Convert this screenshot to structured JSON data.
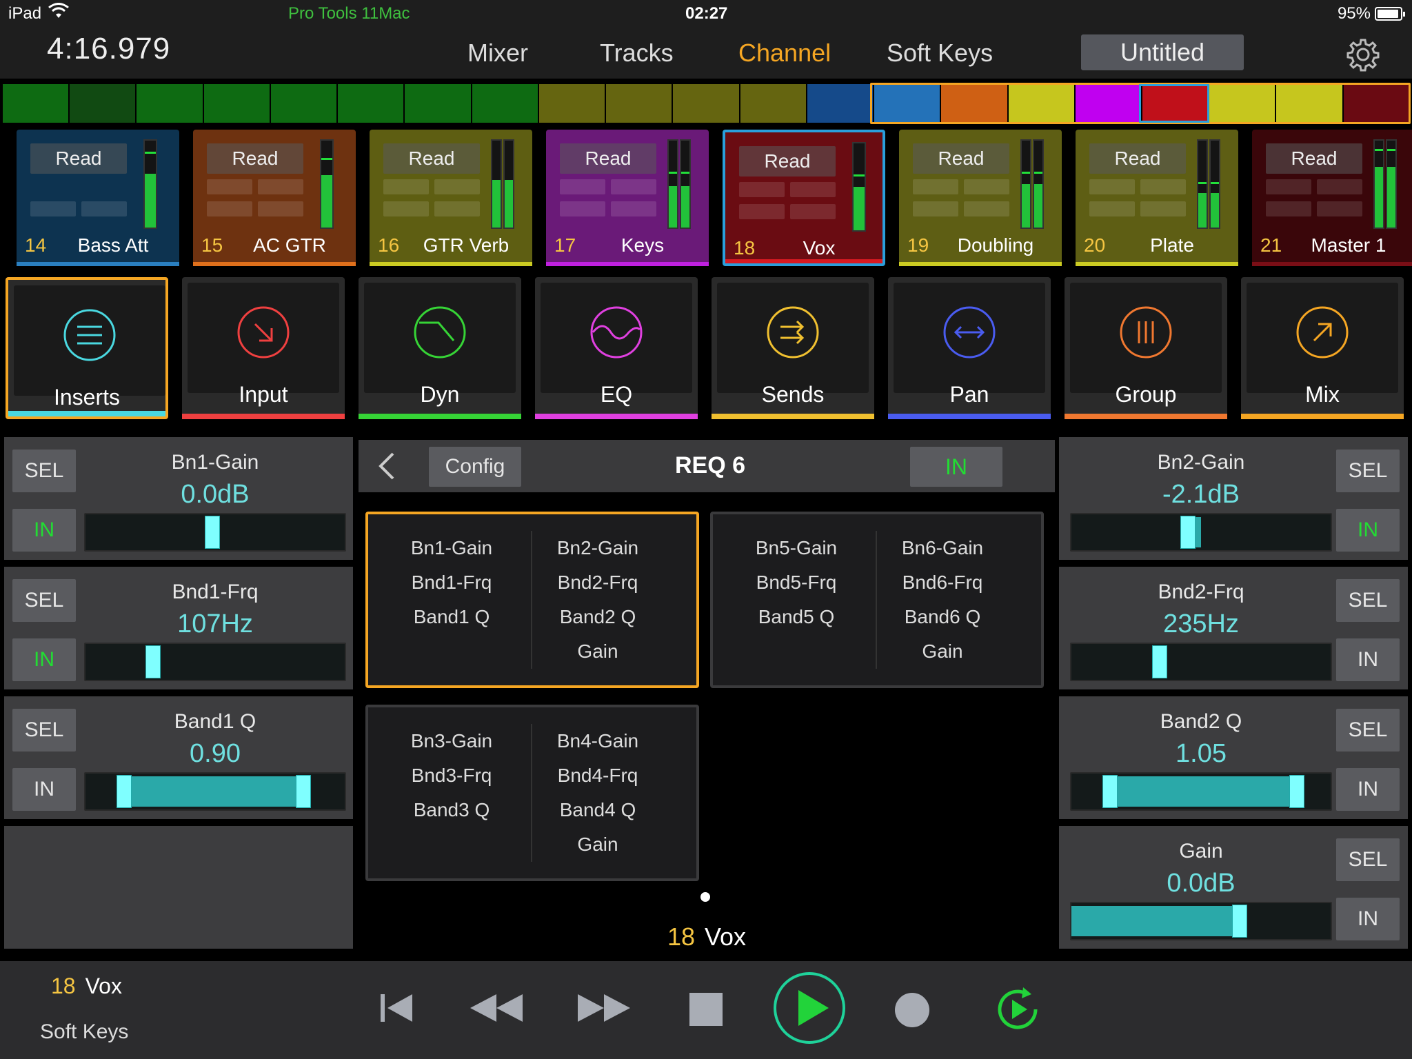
{
  "status_bar": {
    "device": "iPad",
    "app": "Pro Tools 11Mac",
    "clock": "02:27",
    "battery": "95%"
  },
  "header": {
    "counter": "4:16.979",
    "tabs": [
      "Mixer",
      "Tracks",
      "Channel",
      "Soft Keys"
    ],
    "active_tab": "Channel",
    "session_name": "Untitled"
  },
  "color_strip": [
    "#0e6b12",
    "#114a12",
    "#0e6b12",
    "#0e6b12",
    "#0e6b12",
    "#0e6b12",
    "#0e6b12",
    "#0e6b12",
    "#656510",
    "#656510",
    "#656510",
    "#656510",
    "#154a8a",
    "#2472b8",
    "#cf6014",
    "#c6c61e",
    "#c000f0",
    "#c0101a",
    "#c6c61e",
    "#c6c61e",
    "#6a0a12"
  ],
  "tracks": [
    {
      "num": "14",
      "name": "Bass Att",
      "automation": "Read",
      "color": "#0d3350",
      "bar": "#2a7fc0",
      "meter": 0.62,
      "peak": 0.85,
      "stereo": false
    },
    {
      "num": "15",
      "name": "AC GTR",
      "automation": "Read",
      "color": "#6e3210",
      "bar": "#e0701c",
      "meter": 0.6,
      "peak": 0.78,
      "stereo": false
    },
    {
      "num": "16",
      "name": "GTR Verb",
      "automation": "Read",
      "color": "#5e5e12",
      "bar": "#cccc22",
      "meter": 0.55,
      "peak": 0.0,
      "stereo": true
    },
    {
      "num": "17",
      "name": "Keys",
      "automation": "Read",
      "color": "#6a1a78",
      "bar": "#c020e0",
      "meter": 0.48,
      "peak": 0.62,
      "stereo": true
    },
    {
      "num": "18",
      "name": "Vox",
      "automation": "Read",
      "color": "#6a0c12",
      "bar": "#d81a22",
      "meter": 0.5,
      "peak": 0.62,
      "stereo": false
    },
    {
      "num": "19",
      "name": "Doubling",
      "automation": "Read",
      "color": "#5e5e14",
      "bar": "#cccc22",
      "meter": 0.5,
      "peak": 0.62,
      "stereo": true
    },
    {
      "num": "20",
      "name": "Plate",
      "automation": "Read",
      "color": "#5e5e14",
      "bar": "#cccc22",
      "meter": 0.4,
      "peak": 0.5,
      "stereo": true
    },
    {
      "num": "21",
      "name": "Master 1",
      "automation": "Read",
      "color": "#3a060a",
      "bar": "#7a0e16",
      "meter": 0.7,
      "peak": 0.88,
      "stereo": true
    }
  ],
  "selected_track_index": 4,
  "sections": [
    {
      "label": "Inserts",
      "color": "#4ad8e0",
      "icon": "list-icon",
      "selected": true
    },
    {
      "label": "Input",
      "color": "#ef4040",
      "icon": "input-arrow-icon",
      "selected": false
    },
    {
      "label": "Dyn",
      "color": "#36d436",
      "icon": "dynamics-curve-icon",
      "selected": false
    },
    {
      "label": "EQ",
      "color": "#e040e0",
      "icon": "eq-wave-icon",
      "selected": false
    },
    {
      "label": "Sends",
      "color": "#f0c030",
      "icon": "sends-arrows-icon",
      "selected": false
    },
    {
      "label": "Pan",
      "color": "#4a5cf0",
      "icon": "pan-arrows-icon",
      "selected": false
    },
    {
      "label": "Group",
      "color": "#f07830",
      "icon": "group-bars-icon",
      "selected": false
    },
    {
      "label": "Mix",
      "color": "#f5a623",
      "icon": "mix-arrow-icon",
      "selected": false
    }
  ],
  "left_params": [
    {
      "name": "Bn1-Gain",
      "value": "0.0dB",
      "sel": "SEL",
      "in": "IN",
      "in_active": true,
      "thumb": 0.49
    },
    {
      "name": "Bnd1-Frq",
      "value": "107Hz",
      "sel": "SEL",
      "in": "IN",
      "in_active": true,
      "thumb": 0.26
    },
    {
      "name": "Band1 Q",
      "value": "0.90",
      "sel": "SEL",
      "in": "IN",
      "in_active": false,
      "range": [
        0.15,
        0.84
      ]
    }
  ],
  "right_params": [
    {
      "name": "Bn2-Gain",
      "value": "-2.1dB",
      "sel": "SEL",
      "in": "IN",
      "in_active": true,
      "thumb": 0.45,
      "fill": [
        0.45,
        0.5
      ]
    },
    {
      "name": "Bnd2-Frq",
      "value": "235Hz",
      "sel": "SEL",
      "in": "IN",
      "in_active": false,
      "thumb": 0.34
    },
    {
      "name": "Band2 Q",
      "value": "1.05",
      "sel": "SEL",
      "in": "IN",
      "in_active": false,
      "range": [
        0.15,
        0.87
      ]
    },
    {
      "name": "Gain",
      "value": "0.0dB",
      "sel": "SEL",
      "in": "IN",
      "in_active": false,
      "fill": [
        0.0,
        0.65
      ],
      "thumb": 0.65
    }
  ],
  "plugin": {
    "config_label": "Config",
    "name": "REQ 6",
    "in_label": "IN",
    "groups": [
      {
        "c1": [
          "Bn1-Gain",
          "Bnd1-Frq",
          "Band1 Q"
        ],
        "c2": [
          "Bn2-Gain",
          "Bnd2-Frq",
          "Band2 Q",
          "Gain"
        ],
        "selected": true
      },
      {
        "c1": [
          "Bn5-Gain",
          "Bnd5-Frq",
          "Band5 Q"
        ],
        "c2": [
          "Bn6-Gain",
          "Bnd6-Frq",
          "Band6 Q",
          "Gain"
        ],
        "selected": false
      },
      {
        "c1": [
          "Bn3-Gain",
          "Bnd3-Frq",
          "Band3 Q"
        ],
        "c2": [
          "Bn4-Gain",
          "Bnd4-Frq",
          "Band4 Q",
          "Gain"
        ],
        "selected": false
      }
    ]
  },
  "center_track": {
    "num": "18",
    "name": "Vox"
  },
  "transport": {
    "track_num": "18",
    "track_name": "Vox",
    "softkeys_label": "Soft Keys"
  }
}
